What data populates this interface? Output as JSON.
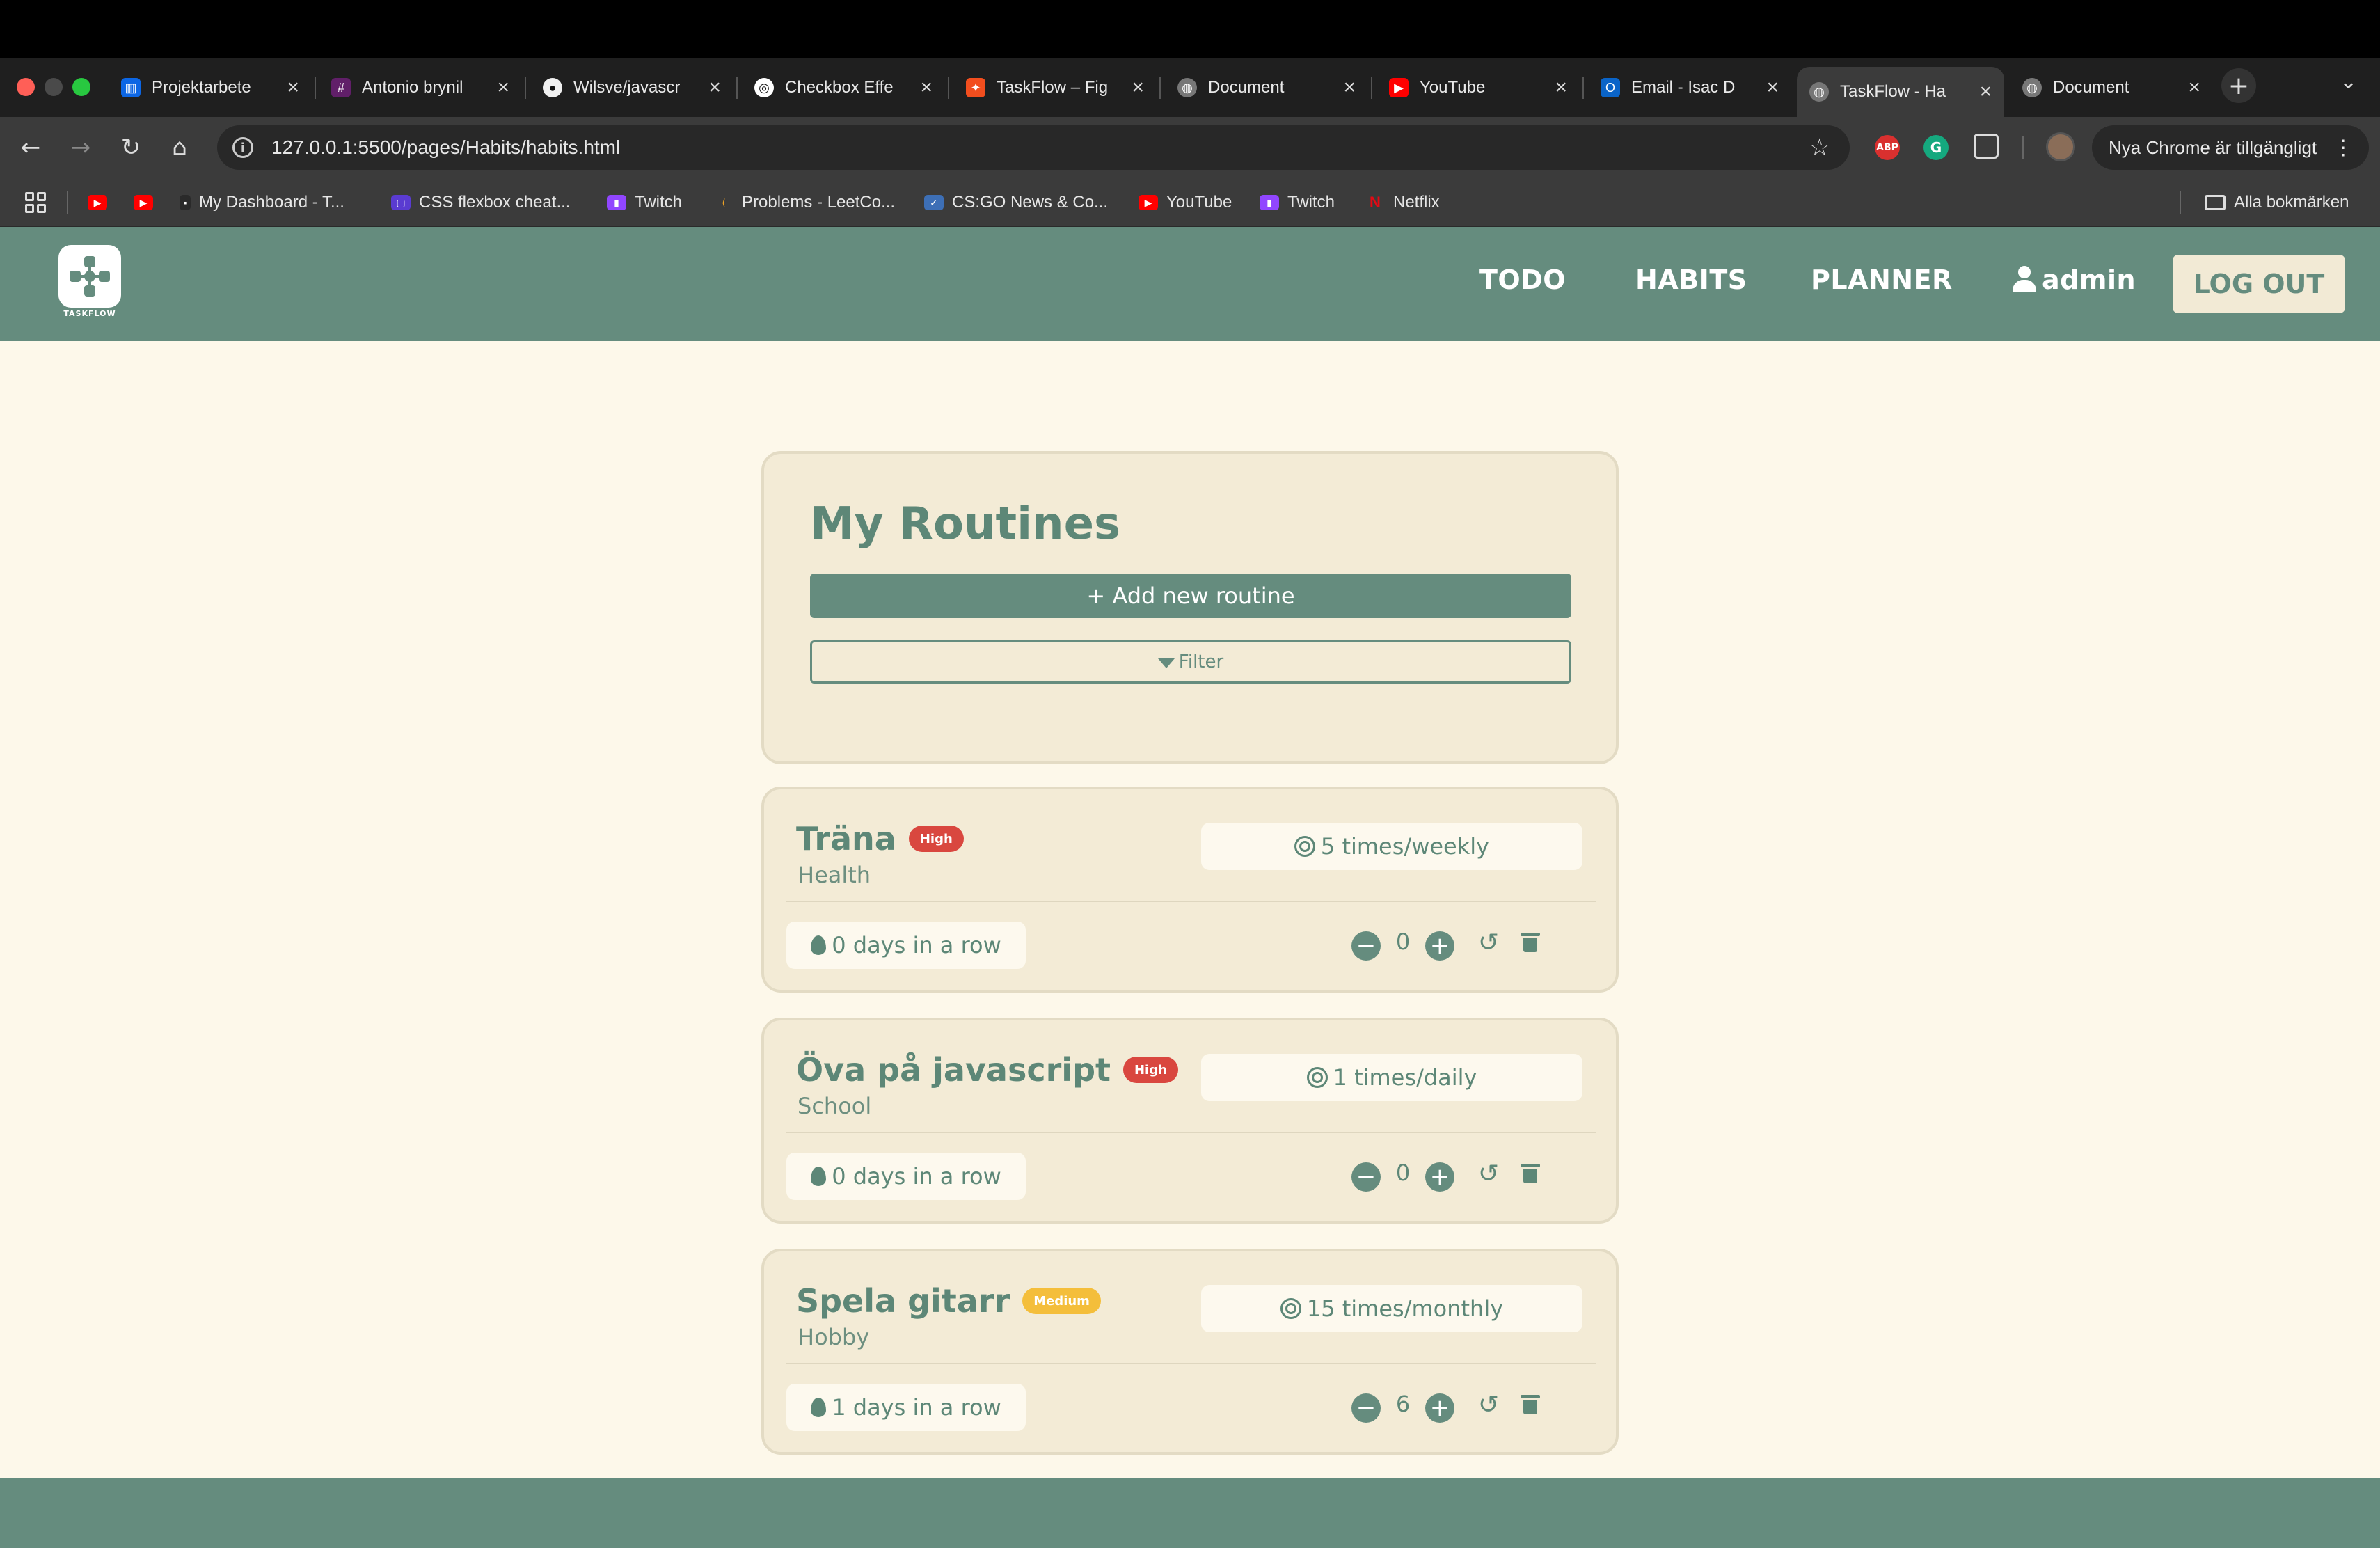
{
  "browser": {
    "tabs": [
      {
        "title": "Projektarbete",
        "favicon": "trello-icon",
        "color": "#0c66e4"
      },
      {
        "title": "Antonio brynil",
        "favicon": "slack-icon",
        "color": "#611f69"
      },
      {
        "title": "Wilsve/javascr",
        "favicon": "github-icon",
        "color": "#24292f"
      },
      {
        "title": "Checkbox Effe",
        "favicon": "codepen-icon",
        "color": "#111111"
      },
      {
        "title": "TaskFlow – Fig",
        "favicon": "figma-icon",
        "color": "#f24e1e"
      },
      {
        "title": "Document",
        "favicon": "globe-icon",
        "color": "#777777"
      },
      {
        "title": "YouTube",
        "favicon": "youtube-icon",
        "color": "#ff0000"
      },
      {
        "title": "Email - Isac D",
        "favicon": "outlook-icon",
        "color": "#0a64c8"
      },
      {
        "title": "TaskFlow - Ha",
        "favicon": "globe-icon",
        "color": "#777777",
        "active": true
      },
      {
        "title": "Document",
        "favicon": "globe-icon",
        "color": "#777777"
      }
    ],
    "new_tab": "+",
    "tab_menu": "⌄",
    "url": "127.0.0.1:5500/pages/Habits/habits.html",
    "update_label": "Nya Chrome är tillgängligt",
    "extensions": [
      "ABP",
      "G"
    ],
    "bookmarks": [
      {
        "label": "",
        "icon": "youtube-icon"
      },
      {
        "label": "",
        "icon": "youtube-icon"
      },
      {
        "label": "My Dashboard - T...",
        "icon": "dashboard-icon"
      },
      {
        "label": "CSS flexbox cheat...",
        "icon": "css-icon"
      },
      {
        "label": "Twitch",
        "icon": "twitch-icon"
      },
      {
        "label": "Problems - LeetCo...",
        "icon": "leetcode-icon"
      },
      {
        "label": "CS:GO News & Co...",
        "icon": "csgo-icon"
      },
      {
        "label": "YouTube",
        "icon": "youtube-icon"
      },
      {
        "label": "Twitch",
        "icon": "twitch-icon"
      },
      {
        "label": "Netflix",
        "icon": "netflix-icon"
      }
    ],
    "all_bookmarks": "Alla bokmärken"
  },
  "app": {
    "logo_text": "TASKFLOW",
    "nav": {
      "todo": "TODO",
      "habits": "HABITS",
      "planner": "PLANNER",
      "user": "admin",
      "logout": "LOG OUT"
    },
    "colors": {
      "primary": "#658c7e",
      "background": "#fdf8ea",
      "card": "#f3ebd6",
      "high": "#d9473f",
      "medium": "#f4be3b"
    },
    "routines": {
      "title": "My Routines",
      "add_label": "+ Add new routine",
      "filter_label": "Filter"
    },
    "habits": [
      {
        "name": "Träna",
        "priority": "High",
        "category": "Health",
        "goal": "5 times/weekly",
        "streak": "0 days in a row",
        "count": "0"
      },
      {
        "name": "Öva på javascript",
        "priority": "High",
        "category": "School",
        "goal": "1 times/daily",
        "streak": "0 days in a row",
        "count": "0"
      },
      {
        "name": "Spela gitarr",
        "priority": "Medium",
        "category": "Hobby",
        "goal": "15 times/monthly",
        "streak": "1 days in a row",
        "count": "6"
      }
    ]
  }
}
